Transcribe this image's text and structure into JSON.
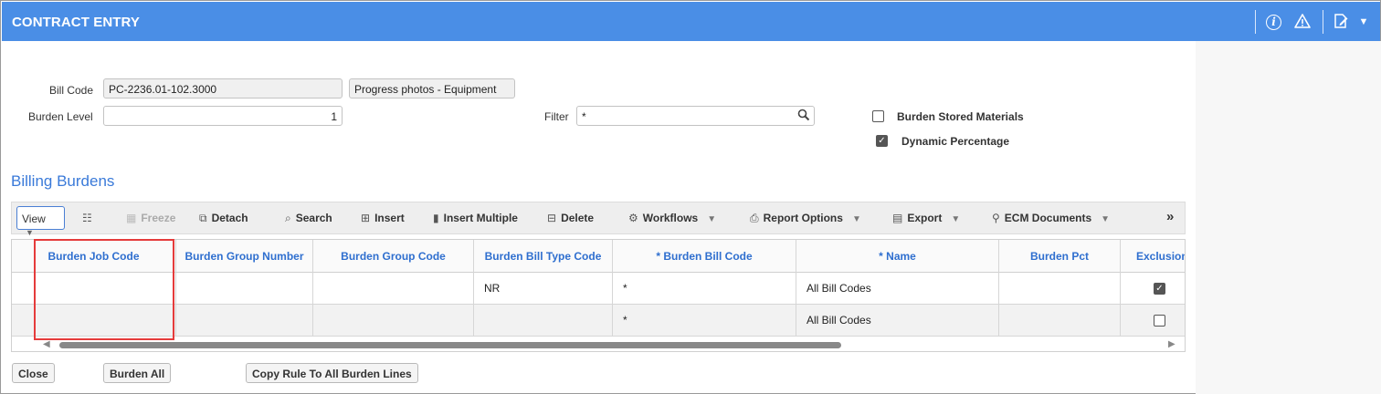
{
  "window": {
    "title": "CONTRACT ENTRY"
  },
  "header_icons": [
    "info-icon",
    "warning-icon",
    "edit-icon",
    "chevron-down-icon"
  ],
  "form": {
    "bill_code_label": "Bill Code",
    "bill_code_value": "PC-2236.01-102.3000",
    "bill_code_desc": "Progress photos - Equipment",
    "burden_level_label": "Burden Level",
    "burden_level_value": "1",
    "filter_label": "Filter",
    "filter_value": "*",
    "burden_stored_materials_label": "Burden Stored Materials",
    "burden_stored_materials_checked": false,
    "dynamic_percentage_label": "Dynamic Percentage",
    "dynamic_percentage_checked": true
  },
  "section": {
    "title": "Billing Burdens"
  },
  "toolbar": {
    "view": "View",
    "freeze": "Freeze",
    "detach": "Detach",
    "search": "Search",
    "insert": "Insert",
    "insert_multiple": "Insert Multiple",
    "delete": "Delete",
    "workflows": "Workflows",
    "report_options": "Report Options",
    "export": "Export",
    "ecm_documents": "ECM Documents",
    "more": "»"
  },
  "grid": {
    "columns": [
      "Burden Job Code",
      "Burden Group Number",
      "Burden Group Code",
      "Burden Bill Type Code",
      "* Burden Bill Code",
      "* Name",
      "Burden Pct",
      "Exclusion"
    ],
    "rows": [
      {
        "job_code": "",
        "group_number": "",
        "group_code": "",
        "bill_type_code": "NR",
        "bill_code": "*",
        "name": "All Bill Codes",
        "pct": "",
        "exclusion": true
      },
      {
        "job_code": "",
        "group_number": "",
        "group_code": "",
        "bill_type_code": "",
        "bill_code": "*",
        "name": "All Bill Codes",
        "pct": "",
        "exclusion": false
      }
    ]
  },
  "buttons": {
    "close": "Close",
    "burden_all": "Burden All",
    "copy_rule": "Copy Rule To All Burden Lines"
  }
}
